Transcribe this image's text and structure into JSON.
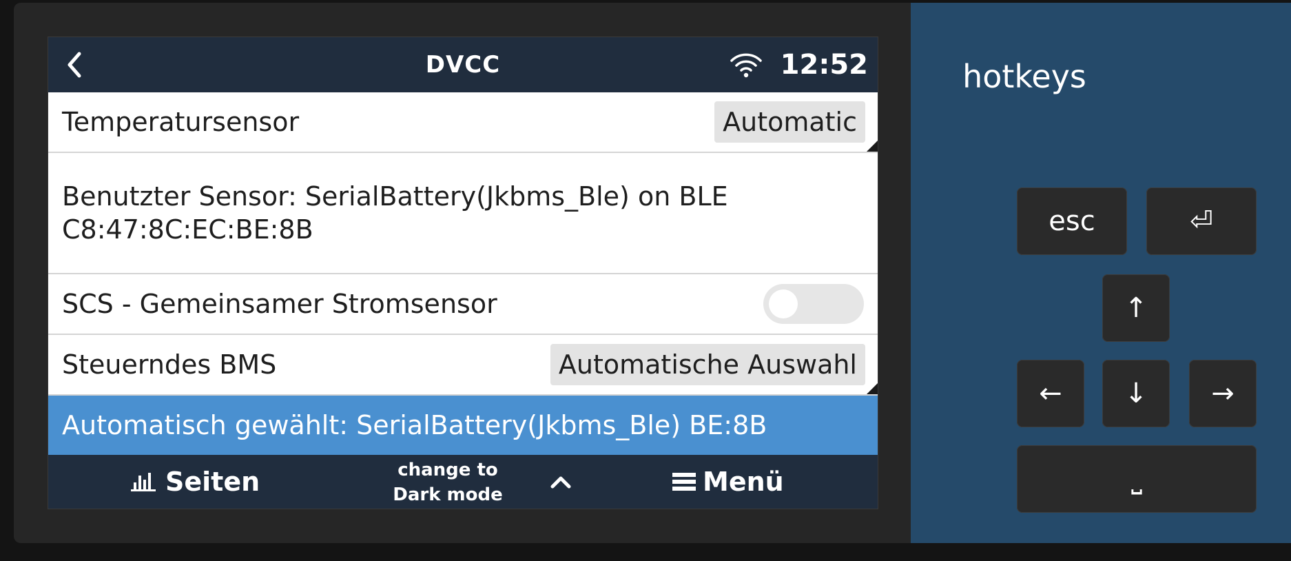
{
  "header": {
    "title": "DVCC",
    "time": "12:52"
  },
  "rows": [
    {
      "label": "Temperatursensor",
      "value": "Automatic"
    },
    {
      "label": "Benutzter Sensor: SerialBattery(Jkbms_Ble) on BLE C8:47:8C:EC:BE:8B"
    },
    {
      "label": "SCS - Gemeinsamer Stromsensor",
      "toggle_on": false
    },
    {
      "label": "Steuerndes BMS",
      "value": "Automatische Auswahl"
    },
    {
      "label": "Automatisch gewählt: SerialBattery(Jkbms_Ble) BE:8B",
      "selected": true
    }
  ],
  "footer": {
    "pages_label": "Seiten",
    "dark_mode_line1": "change to",
    "dark_mode_line2": "Dark mode",
    "menu_label": "Menü"
  },
  "hotkeys": {
    "title": "hotkeys",
    "esc": "esc",
    "enter": "⏎",
    "up": "↑",
    "left": "←",
    "down": "↓",
    "right": "→",
    "space": "⎵"
  },
  "colors": {
    "bar_background": "#202d3e",
    "selection_accent": "#4a90d0",
    "hotkeys_panel": "#254a6a"
  },
  "icons": [
    "back-chevron-icon",
    "wifi-icon",
    "bar-chart-icon",
    "chevron-up-icon",
    "hamburger-menu-icon"
  ]
}
